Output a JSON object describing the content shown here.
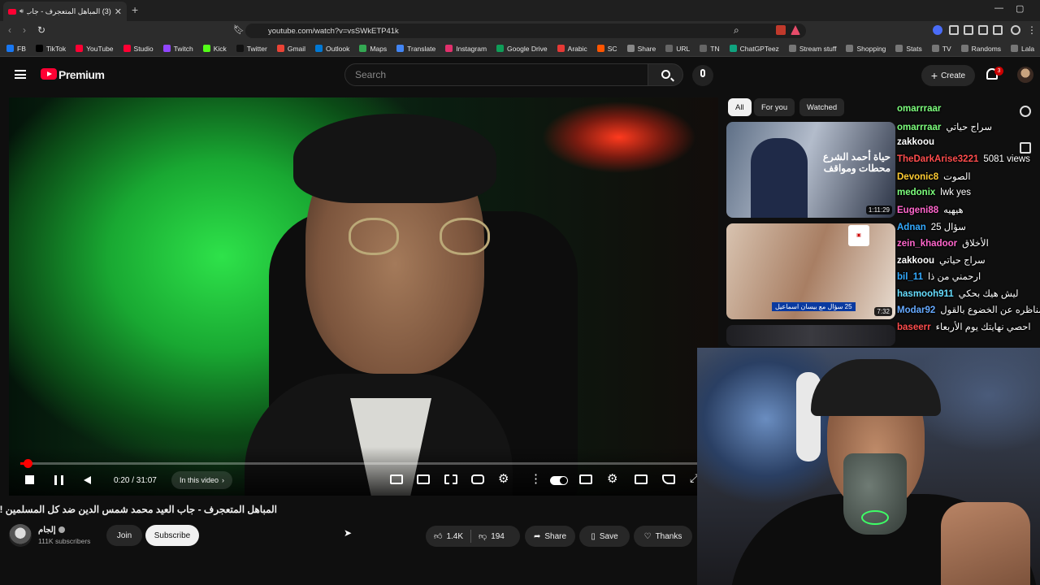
{
  "browser": {
    "tab_title": "(3) المباهل المتعجرف - جاب ال...",
    "url": "youtube.com/watch?v=vsSWkETP41k",
    "bookmarks": [
      "FB",
      "TikTok",
      "YouTube",
      "Studio",
      "Twitch",
      "Kick",
      "Twitter",
      "Gmail",
      "Outlook",
      "Maps",
      "Translate",
      "Instagram",
      "Google Drive",
      "Arabic",
      "SC",
      "Share",
      "URL",
      "TN",
      "ChatGPTeez",
      "Stream stuff",
      "Shopping",
      "Stats",
      "TV",
      "Randoms",
      "Lala"
    ]
  },
  "youtube": {
    "logo_text": "Premium",
    "search_placeholder": "Search",
    "create_label": "Create",
    "notification_count": "3"
  },
  "player": {
    "time": "0:20 / 31:07",
    "in_this_video": "In this video",
    "progress_fraction": 0.011
  },
  "video": {
    "title": "المباهل المتعجرف - جاب العيد محمد شمس الدين ضد كل المسلمين !",
    "channel": "إلجام",
    "subscribers": "111K subscribers",
    "join_label": "Join",
    "subscribe_label": "Subscribe",
    "likes": "1.4K",
    "dislikes": "194",
    "share_label": "Share",
    "save_label": "Save",
    "thanks_label": "Thanks"
  },
  "recommendations": {
    "chips": [
      "All",
      "For you",
      "Watched"
    ],
    "items": [
      {
        "thumb_text": "حياة أحمد الشرع محطات ومواقف",
        "duration": "1:11:29"
      },
      {
        "thumb_text": "25 سؤال مع بيسان اسماعيل",
        "duration": "7:32"
      }
    ]
  },
  "chat": [
    {
      "user": "omarrraar",
      "msg": "",
      "color": "#7dff7d"
    },
    {
      "user": "omarrraar",
      "msg": "سراج حياتي",
      "color": "#7dff7d"
    },
    {
      "user": "zakkoou",
      "msg": "",
      "color": "#ffffff"
    },
    {
      "user": "TheDarkArise3221",
      "msg": "5081 views",
      "color": "#ff4d4d"
    },
    {
      "user": "Devonic8",
      "msg": "الصوت",
      "color": "#ffcc33"
    },
    {
      "user": "medonix",
      "msg": "lwk yes",
      "color": "#7dff7d"
    },
    {
      "user": "Eugeni88",
      "msg": "هيهيه",
      "color": "#ff66cc"
    },
    {
      "user": "Adnan",
      "msg": "25 سؤال",
      "color": "#33aaff"
    },
    {
      "user": "zein_khadoor",
      "msg": "الأخلاق",
      "color": "#ff66cc"
    },
    {
      "user": "zakkoou",
      "msg": "سراج حياتي",
      "color": "#ffffff"
    },
    {
      "user": "bil_11",
      "msg": "ارحمني من ذا",
      "color": "#33aaff"
    },
    {
      "user": "hasmooh911",
      "msg": "ليش هيك بحكي",
      "color": "#66ddff"
    },
    {
      "user": "Modar92",
      "msg": "مناظره عن الخضوع بالقول",
      "color": "#66aaff"
    },
    {
      "user": "baseerr",
      "msg": "احصي نهايتك يوم الأربعاء",
      "color": "#ff4d4d"
    }
  ]
}
